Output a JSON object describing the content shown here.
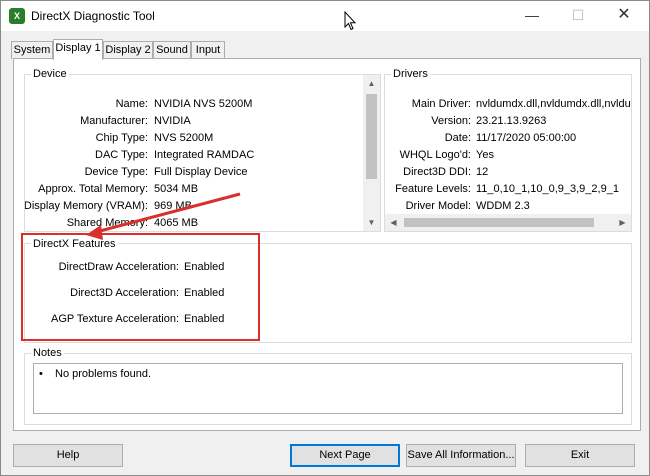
{
  "window": {
    "title": "DirectX Diagnostic Tool",
    "icon": "directx-icon"
  },
  "title_controls": {
    "minimize": "—",
    "maximize": "☐",
    "close": "✕"
  },
  "tabs": [
    {
      "label": "System"
    },
    {
      "label": "Display 1"
    },
    {
      "label": "Display 2"
    },
    {
      "label": "Sound"
    },
    {
      "label": "Input"
    }
  ],
  "active_tab": "Display 1",
  "device": {
    "heading": "Device",
    "rows": [
      {
        "label": "Name:",
        "value": "NVIDIA NVS 5200M"
      },
      {
        "label": "Manufacturer:",
        "value": "NVIDIA"
      },
      {
        "label": "Chip Type:",
        "value": "NVS 5200M"
      },
      {
        "label": "DAC Type:",
        "value": "Integrated RAMDAC"
      },
      {
        "label": "Device Type:",
        "value": "Full Display Device"
      },
      {
        "label": "Approx. Total Memory:",
        "value": "5034 MB"
      },
      {
        "label": "Display Memory (VRAM):",
        "value": "969 MB"
      },
      {
        "label": "Shared Memory:",
        "value": "4065 MB"
      }
    ]
  },
  "drivers": {
    "heading": "Drivers",
    "rows": [
      {
        "label": "Main Driver:",
        "value": "nvldumdx.dll,nvldumdx.dll,nvldumdx.c"
      },
      {
        "label": "Version:",
        "value": "23.21.13.9263"
      },
      {
        "label": "Date:",
        "value": "11/17/2020 05:00:00"
      },
      {
        "label": "WHQL Logo'd:",
        "value": "Yes"
      },
      {
        "label": "Direct3D DDI:",
        "value": "12"
      },
      {
        "label": "Feature Levels:",
        "value": "11_0,10_1,10_0,9_3,9_2,9_1"
      },
      {
        "label": "Driver Model:",
        "value": "WDDM 2.3"
      }
    ]
  },
  "features": {
    "heading": "DirectX Features",
    "rows": [
      {
        "label": "DirectDraw Acceleration:",
        "value": "Enabled"
      },
      {
        "label": "Direct3D Acceleration:",
        "value": "Enabled"
      },
      {
        "label": "AGP Texture Acceleration:",
        "value": "Enabled"
      }
    ]
  },
  "notes": {
    "heading": "Notes",
    "bullet": "•",
    "items": [
      "No problems found."
    ]
  },
  "buttons": {
    "help": "Help",
    "next_page": "Next Page",
    "save_all": "Save All Information...",
    "exit": "Exit"
  },
  "annotation": {
    "highlight_color": "#d9302e"
  },
  "colors": {
    "focus_blue": "#0078d7",
    "window_bg": "#f0f0f0"
  }
}
